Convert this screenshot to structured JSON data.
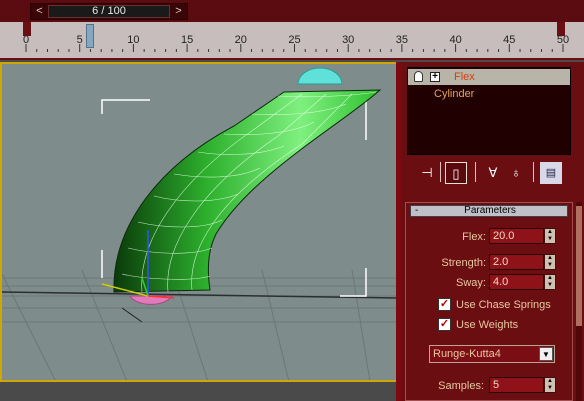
{
  "time_slider": {
    "frame_text": "6 / 100",
    "prev_icon": "chevron-left-icon",
    "next_icon": "chevron-right-icon",
    "prev_glyph": "<",
    "next_glyph": ">",
    "current_frame": 6,
    "total_frames": 100
  },
  "track_ruler": {
    "labels": [
      "0",
      "5",
      "10",
      "15",
      "20",
      "25",
      "30",
      "35",
      "40",
      "45",
      "50"
    ],
    "time_marker_frame": 6
  },
  "modifier_stack": {
    "items": [
      {
        "label": "Flex",
        "selected": true,
        "icon": "lightbulb-icon"
      },
      {
        "label": "Cylinder",
        "selected": false
      }
    ],
    "expand_glyph": "+"
  },
  "stack_toolbar": {
    "pin_icon": "pin-stack-icon",
    "show_end_icon": "show-end-result-icon",
    "unique_icon": "make-unique-icon",
    "remove_icon": "remove-modifier-icon",
    "configure_icon": "configure-sets-icon",
    "pin_glyph": "⊣",
    "show_end_glyph": "▯",
    "unique_glyph": "∀",
    "remove_glyph": "♁",
    "configure_glyph": "▤"
  },
  "parameters": {
    "rollout_title": "Parameters",
    "rollout_toggle": "-",
    "flex": {
      "label": "Flex:",
      "value": "20.0"
    },
    "strength": {
      "label": "Strength:",
      "value": "2.0"
    },
    "sway": {
      "label": "Sway:",
      "value": "4.0"
    },
    "use_chase_springs": {
      "label": "Use Chase Springs",
      "checked": true,
      "glyph": "✓"
    },
    "use_weights": {
      "label": "Use Weights",
      "checked": true,
      "glyph": "✓"
    },
    "solver": {
      "value": "Runge-Kutta4",
      "arrow": "▼"
    },
    "samples": {
      "label": "Samples:",
      "value": "5"
    }
  },
  "colors": {
    "panel_bg": "#6a0e12",
    "viewport_bg": "#7f8c8c",
    "viewport_border": "#cfa700",
    "object_green": "#2fbf2f",
    "gizmo_cyan": "#5fe0d8",
    "gizmo_pink": "#e07ab8"
  }
}
